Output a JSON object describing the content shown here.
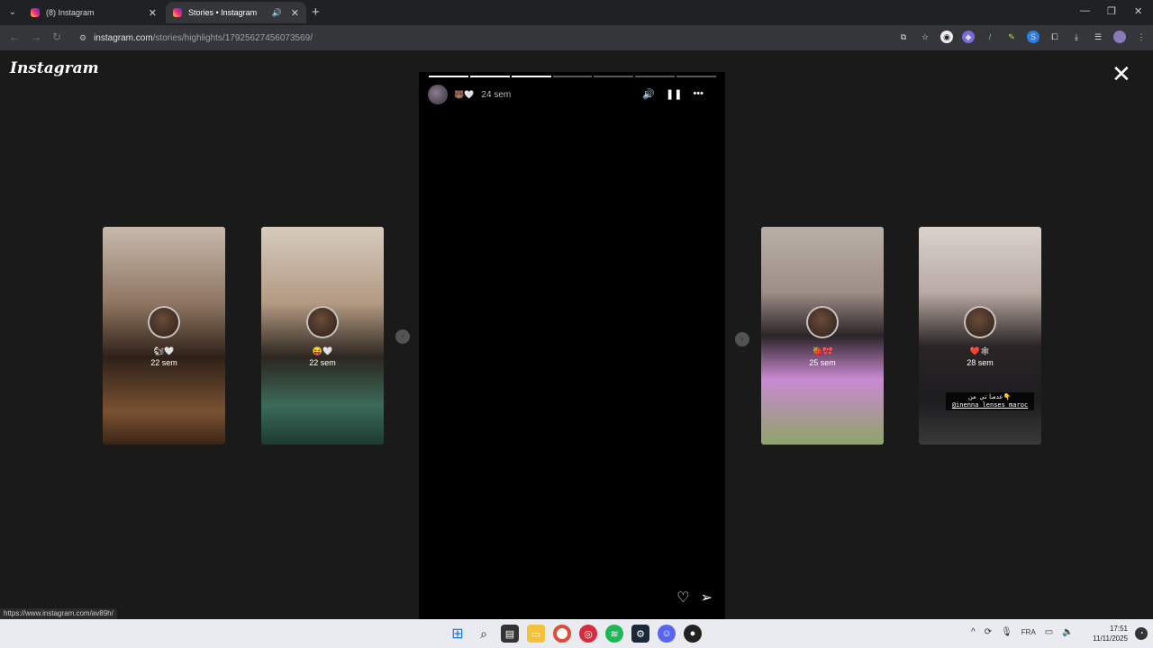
{
  "browser": {
    "tabs": [
      {
        "title": "(8) Instagram"
      },
      {
        "title": "Stories • Instagram"
      }
    ],
    "url_host": "instagram.com",
    "url_path": "/stories/highlights/17925627456073569/"
  },
  "page": {
    "logo_text": "Instagram",
    "main_story": {
      "user_emoji": "🐻🤍",
      "time": "24 sem",
      "progress_total": 7,
      "progress_done": 3
    },
    "previews": [
      {
        "name": "🐿🤍",
        "time": "22 sem"
      },
      {
        "name": "😝🤍",
        "time": "22 sem"
      },
      {
        "name": "🍓🎀",
        "time": "25 sem"
      },
      {
        "name": "❤️🕸",
        "time": "28 sem",
        "tag_line1": "عدساتي من👇",
        "tag_line2": "@inenna_lenses_maroc"
      }
    ],
    "status_url": "https://www.instagram.com/av89h/"
  },
  "taskbar": {
    "lang": "FRA",
    "time": "17:51",
    "date": "11/11/2025"
  }
}
